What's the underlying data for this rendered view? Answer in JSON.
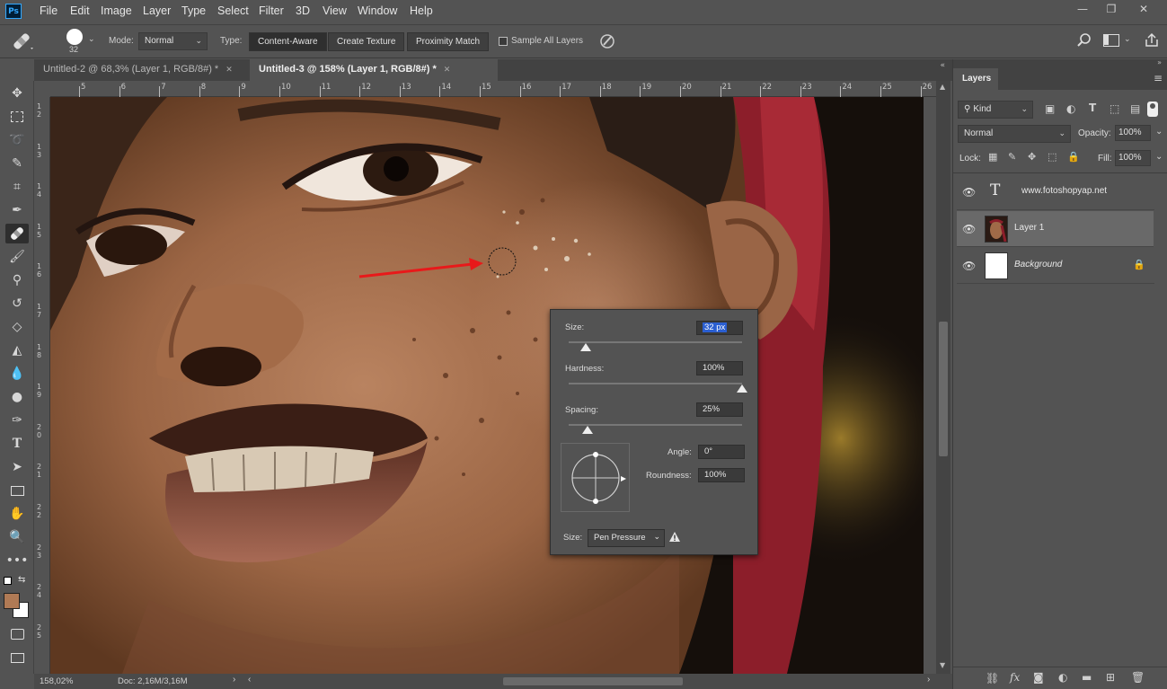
{
  "app": {
    "logo": "Ps"
  },
  "menu": [
    "File",
    "Edit",
    "Image",
    "Layer",
    "Type",
    "Select",
    "Filter",
    "3D",
    "View",
    "Window",
    "Help"
  ],
  "options": {
    "brush_size": "32",
    "mode_label": "Mode:",
    "mode_value": "Normal",
    "type_label": "Type:",
    "type_buttons": [
      "Content-Aware",
      "Create Texture",
      "Proximity Match"
    ],
    "sample_all_layers": "Sample All Layers"
  },
  "tabs": [
    {
      "label": "Untitled-2 @ 68,3% (Layer 1, RGB/8#) *",
      "active": false
    },
    {
      "label": "Untitled-3 @ 158% (Layer 1, RGB/8#) *",
      "active": true
    }
  ],
  "hruler_ticks": [
    "5",
    "6",
    "7",
    "8",
    "9",
    "10",
    "11",
    "12",
    "13",
    "14",
    "15",
    "16",
    "17",
    "18",
    "19",
    "20",
    "21",
    "22",
    "23",
    "24",
    "25",
    "26"
  ],
  "vruler_ticks": [
    "1 2",
    "1 3",
    "1 4",
    "1 5",
    "1 6",
    "1 7",
    "1 8",
    "1 9",
    "2 0",
    "2 1",
    "2 2",
    "2 3",
    "2 4",
    "2 5"
  ],
  "brush_popup": {
    "size_label": "Size:",
    "size_value": "32 px",
    "size_fraction": 0.1,
    "hardness_label": "Hardness:",
    "hardness_value": "100%",
    "hardness_fraction": 1.0,
    "spacing_label": "Spacing:",
    "spacing_value": "25%",
    "spacing_fraction": 0.11,
    "angle_label": "Angle:",
    "angle_value": "0°",
    "roundness_label": "Roundness:",
    "roundness_value": "100%",
    "size_control_label": "Size:",
    "size_control_value": "Pen Pressure"
  },
  "status": {
    "zoom": "158,02%",
    "doc": "Doc: 2,16M/3,16M"
  },
  "layers_panel": {
    "title": "Layers",
    "filter_kind": "Kind",
    "blend_mode": "Normal",
    "opacity_label": "Opacity:",
    "opacity_value": "100%",
    "lock_label": "Lock:",
    "fill_label": "Fill:",
    "fill_value": "100%",
    "layers": [
      {
        "name": "www.fotoshopyap.net",
        "type": "text",
        "selected": false
      },
      {
        "name": "Layer 1",
        "type": "image",
        "selected": true
      },
      {
        "name": "Background",
        "type": "background",
        "selected": false
      }
    ]
  },
  "colors": {
    "foreground": "#b07a55",
    "background": "#ffffff",
    "accent": "#31a8ff",
    "arrow": "#e8191a"
  }
}
